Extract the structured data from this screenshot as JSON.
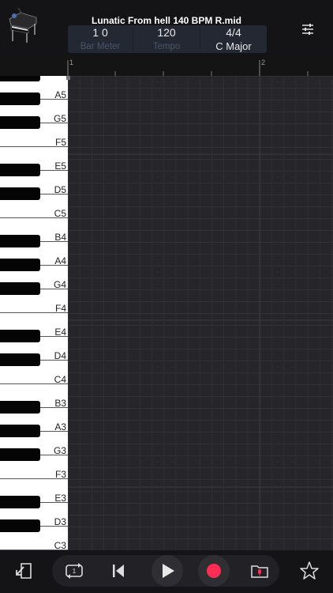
{
  "header": {
    "title": "Lunatic From hell 140 BPM R.mid",
    "info": [
      {
        "value": "1  0",
        "label": "Bar   Meter"
      },
      {
        "value": "120",
        "label": "Tempo"
      },
      {
        "value": "4/4",
        "label": "C Major"
      }
    ]
  },
  "ruler": {
    "bar1": "1",
    "bar2": "2"
  },
  "keyboard": {
    "labels": [
      "A5",
      "G5",
      "F5",
      "E5",
      "D5",
      "C5",
      "B4",
      "A4",
      "G4",
      "F4",
      "E4",
      "D4",
      "C4",
      "B3",
      "A3",
      "G3",
      "F3",
      "E3",
      "D3",
      "C3"
    ]
  },
  "toolbar": {
    "loop_number": "1"
  },
  "colors": {
    "background": "#1c1c1e",
    "grid": "#26262a",
    "record": "#ff2d55",
    "pill": "#222226"
  }
}
